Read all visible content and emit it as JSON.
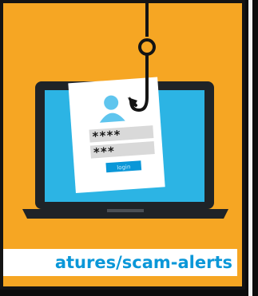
{
  "illustration": {
    "password_row_1": "****",
    "password_row_2": "***",
    "button_label": "login"
  },
  "banner": {
    "text": "atures/scam-alerts"
  },
  "colors": {
    "background": "#f6a623",
    "screen": "#2cb4e4",
    "accent_blue": "#0a97d8",
    "frame": "#141414"
  }
}
